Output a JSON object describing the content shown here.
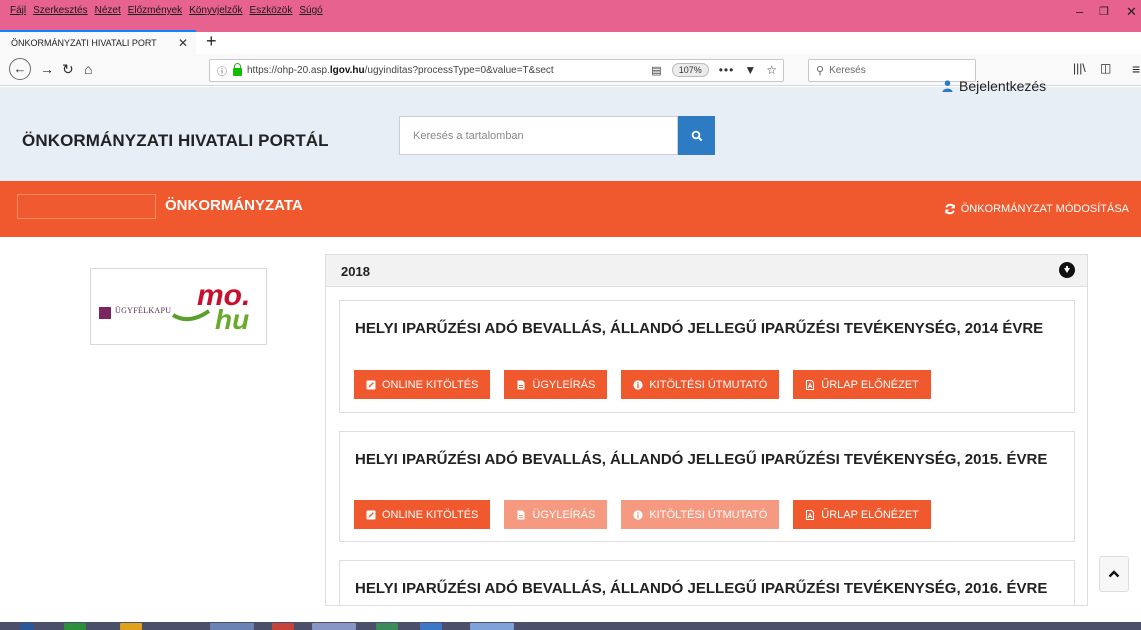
{
  "browser": {
    "menu": [
      "Fájl",
      "Szerkesztés",
      "Nézet",
      "Előzmények",
      "Könyvjelzők",
      "Eszközök",
      "Súgó"
    ],
    "tab_title": "ÖNKORMÁNYZATI HIVATALI PORT",
    "url_prefix": "https://ohp-20.asp.",
    "url_host": "lgov.hu",
    "url_path": "/ugyinditas?processType=0&value=T&sect",
    "zoom": "107%",
    "search_placeholder": "Keresés"
  },
  "header": {
    "title": "ÖNKORMÁNYZATI HIVATALI PORTÁL",
    "search_placeholder": "Keresés a tartalomban",
    "login_label": "Bejelentkezés"
  },
  "band": {
    "municipality": "ÖNKORMÁNYZATA",
    "modify_label": "ÖNKORMÁNYZAT MÓDOSÍTÁSA"
  },
  "logo": {
    "text": "ÜGYFÉLKAPU",
    "big_top": "mo.",
    "big_bottom": "hu"
  },
  "panel": {
    "year": "2018",
    "cards": [
      {
        "title": "HELYI IPARŰZÉSI ADÓ BEVALLÁS, ÁLLANDÓ JELLEGŰ IPARŰZÉSI TEVÉKENYSÉG, 2014 ÉVRE",
        "buttons": [
          "ONLINE KITÖLTÉS",
          "ÜGYLEÍRÁS",
          "KITÖLTÉSI ÚTMUTATÓ",
          "ŰRLAP ELŐNÉZET"
        ]
      },
      {
        "title": "HELYI IPARŰZÉSI ADÓ BEVALLÁS, ÁLLANDÓ JELLEGŰ IPARŰZÉSI TEVÉKENYSÉG, 2015. ÉVRE",
        "buttons": [
          "ONLINE KITÖLTÉS",
          "ÜGYLEÍRÁS",
          "KITÖLTÉSI ÚTMUTATÓ",
          "ŰRLAP ELŐNÉZET"
        ]
      },
      {
        "title": "HELYI IPARŰZÉSI ADÓ BEVALLÁS, ÁLLANDÓ JELLEGŰ IPARŰZÉSI TEVÉKENYSÉG, 2016. ÉVRE"
      }
    ]
  },
  "colors": {
    "accent": "#f0582e",
    "accent_light": "#f59a80",
    "menubar": "#e8628f",
    "search_button": "#2d7bc2"
  }
}
